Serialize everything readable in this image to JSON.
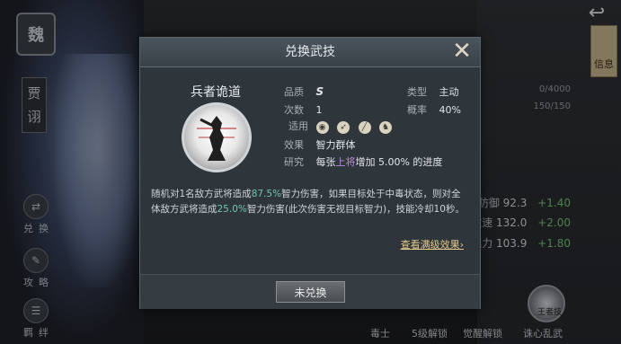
{
  "background": {
    "faction": "魏",
    "hero_name": "贾诩",
    "left_menu": [
      {
        "icon": "exchange-icon",
        "label": "兑换"
      },
      {
        "icon": "strategy-icon",
        "label": "攻略"
      },
      {
        "icon": "bond-icon",
        "label": "羁绊"
      }
    ],
    "info_tab": "信息",
    "exp": [
      "0/4000",
      "150/150"
    ],
    "stats": [
      {
        "name": "防御",
        "value": "92.3",
        "plus": "+1.40"
      },
      {
        "name": "攻速",
        "value": "132.0",
        "plus": "+2.00"
      },
      {
        "name": "魅力",
        "value": "103.9",
        "plus": "+1.80"
      }
    ],
    "bottom_labels": [
      "毒士",
      "5级解锁",
      "觉醒解锁",
      "诛心乱武"
    ],
    "skill_circle_label": "王者技"
  },
  "modal": {
    "title": "兑换武技",
    "skill_name": "兵者诡道",
    "quality_label": "品质",
    "quality_value": "S",
    "type_label": "类型",
    "type_value": "主动",
    "count_label": "次数",
    "count_value": "1",
    "rate_label": "概率",
    "rate_value": "40%",
    "applicable_label": "适用",
    "effect_label": "效果",
    "effect_value": "智力群体",
    "research_label": "研究",
    "research_prefix": "每张",
    "research_highlight": "上将",
    "research_suffix": "增加 5.00% 的进度",
    "desc_part1": "随机对1名敌方武将造成",
    "desc_pct1": "87.5%",
    "desc_part2": "智力伤害，如果目标处于中毒状态，则对全体敌方武将造成",
    "desc_pct2": "25.0%",
    "desc_part3": "智力伤害(此次伤害无视目标智力)，技能冷却10秒。",
    "view_full": "查看满级效果",
    "exchange_button": "未兑换"
  },
  "colors": {
    "highlight_green": "#6fc5b0",
    "highlight_purple": "#b78be0",
    "link_gold": "#e2c98a"
  }
}
